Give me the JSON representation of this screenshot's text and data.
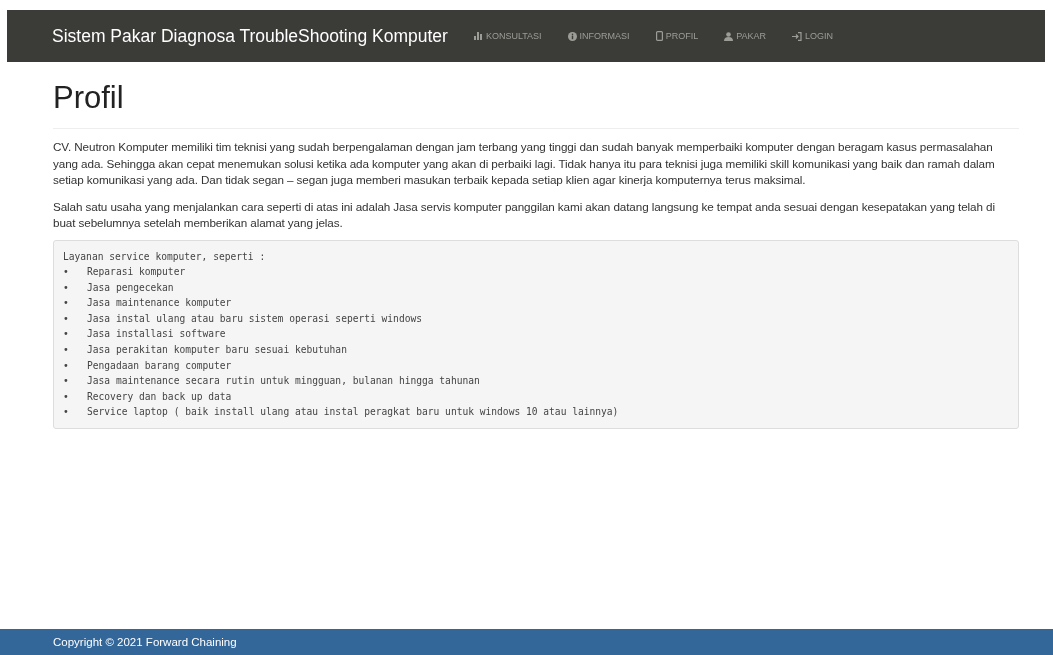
{
  "navbar": {
    "brand": "Sistem Pakar Diagnosa TroubleShooting Komputer",
    "items": [
      {
        "label": "KONSULTASI"
      },
      {
        "label": "INFORMASI"
      },
      {
        "label": "PROFIL"
      },
      {
        "label": "PAKAR"
      },
      {
        "label": "LOGIN"
      }
    ]
  },
  "page": {
    "title": "Profil",
    "paragraphs": [
      "CV. Neutron Komputer memiliki tim teknisi yang sudah berpengalaman dengan jam terbang yang tinggi dan sudah banyak memperbaiki komputer dengan beragam kasus permasalahan yang ada. Sehingga akan cepat menemukan solusi ketika ada komputer yang akan di perbaiki lagi. Tidak hanya itu para teknisi juga memiliki skill komunikasi yang baik dan ramah dalam setiap komunikasi yang ada. Dan tidak segan – segan juga memberi masukan terbaik kepada setiap klien agar kinerja komputernya terus maksimal.",
      "Salah satu usaha yang menjalankan cara seperti di atas ini adalah Jasa servis komputer panggilan kami akan datang langsung ke tempat anda sesuai dengan kesepatakan yang telah di buat sebelumnya setelah memberikan alamat yang jelas."
    ],
    "services": {
      "heading": "Layanan service komputer, seperti :",
      "items": [
        {
          "bullet": "•",
          "text": "Reparasi komputer"
        },
        {
          "bullet": "•",
          "text": "Jasa pengecekan"
        },
        {
          "bullet": "•",
          "text": "Jasa maintenance komputer"
        },
        {
          "bullet": "•",
          "text": "Jasa instal ulang atau baru sistem operasi seperti windows"
        },
        {
          "bullet": "•",
          "text": "Jasa installasi software"
        },
        {
          "bullet": "•",
          "text": "Jasa perakitan komputer baru sesuai kebutuhan"
        },
        {
          "bullet": "•",
          "text": "Pengadaan barang computer"
        },
        {
          "bullet": "•",
          "text": "Jasa maintenance secara rutin untuk mingguan, bulanan hingga tahunan"
        },
        {
          "bullet": "•",
          "text": "Recovery dan back up data"
        },
        {
          "bullet": "•",
          "text": "Service laptop ( baik install ulang atau instal peragkat baru untuk windows 10 atau lainnya)"
        }
      ]
    }
  },
  "footer": {
    "text": "Copyright © 2021 Forward Chaining"
  }
}
